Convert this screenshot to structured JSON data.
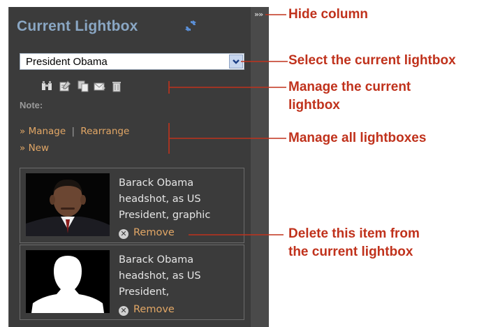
{
  "panel": {
    "title": "Current Lightbox",
    "selected_lightbox": "President Obama",
    "note_label": "Note:",
    "links": {
      "manage": "Manage",
      "separator": "|",
      "rearrange": "Rearrange",
      "new": "New",
      "bullet": "»"
    },
    "items": [
      {
        "caption": "Barack Obama headshot, as US President, graphic",
        "remove_label": "Remove",
        "thumbnail": "photo"
      },
      {
        "caption": "Barack Obama headshot, as US President,",
        "remove_label": "Remove",
        "thumbnail": "silhouette"
      }
    ],
    "toolbar_icons": [
      "binoculars-icon",
      "edit-icon",
      "copy-icon",
      "email-icon",
      "delete-icon"
    ]
  },
  "hide_toggle": "»",
  "annotations": {
    "hide_column": "Hide column",
    "select_lightbox": "Select the current lightbox",
    "manage_current_1": "Manage the current",
    "manage_current_2": "lightbox",
    "manage_all": "Manage all lightboxes",
    "delete_item_1": "Delete this item from",
    "delete_item_2": "the current lightbox"
  },
  "colors": {
    "panel_bg": "#3b3b3b",
    "title": "#8aa7c4",
    "link": "#e2a766",
    "annotation": "#c0321c"
  }
}
